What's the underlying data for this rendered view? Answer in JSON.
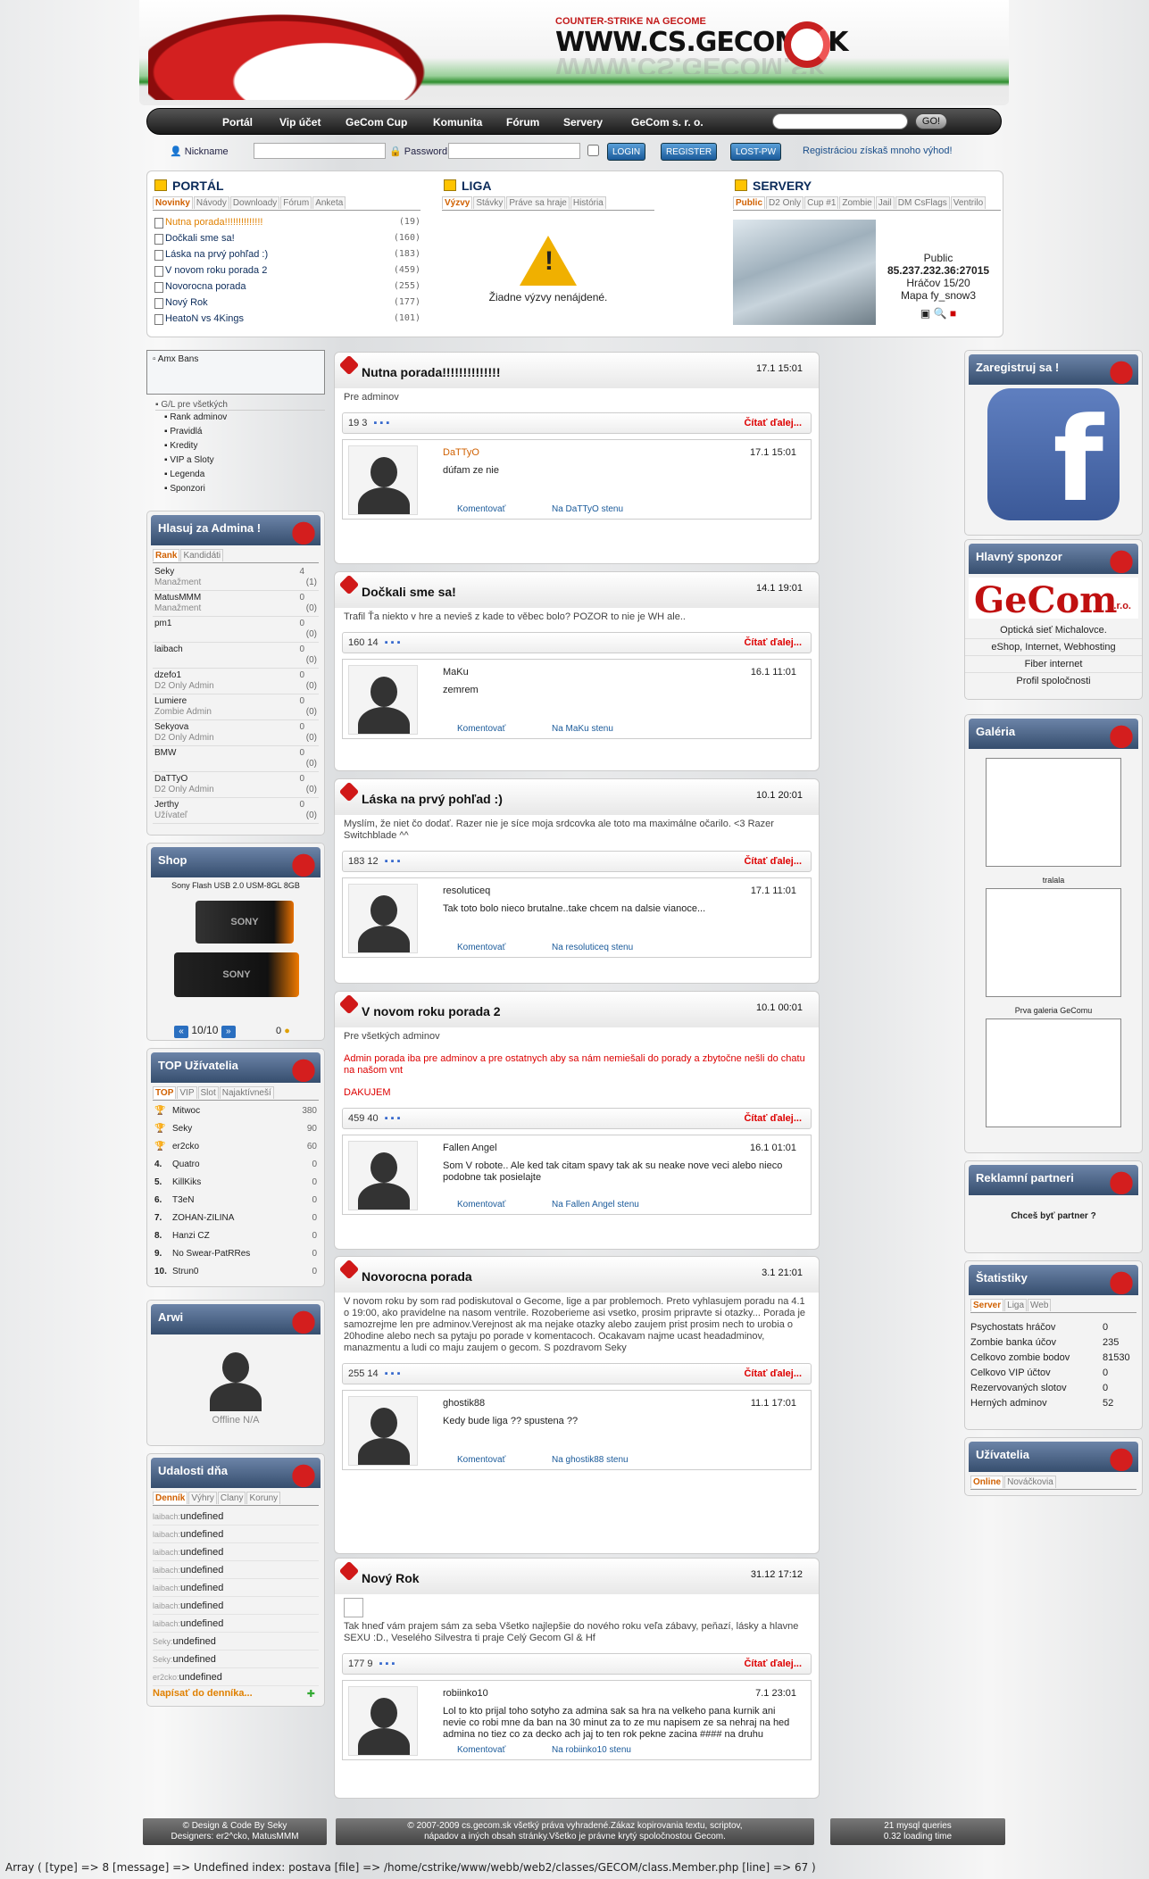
{
  "header": {
    "small": "COUNTER-STRIKE NA GECOME",
    "big": "WWW.CS.GECOM.SK"
  },
  "nav": {
    "items": [
      "Portál",
      "Vip účet",
      "GeCom Cup",
      "Komunita",
      "Fórum",
      "Servery",
      "GeCom s. r. o."
    ],
    "go": "GO!"
  },
  "login": {
    "nickname": "Nickname",
    "password": "Password",
    "login_btn": "LOGIN",
    "register_btn": "REGISTER",
    "lost_btn": "LOST-PW",
    "promo": "Registráciou získaš mnoho výhod!"
  },
  "portal": {
    "title": "PORTÁL",
    "tabs": [
      "Novinky",
      "Návody",
      "Downloady",
      "Fórum",
      "Anketa"
    ],
    "items": [
      {
        "t": "Nutna porada!!!!!!!!!!!!!!",
        "n": "(19)"
      },
      {
        "t": "Dočkali sme sa!",
        "n": "(160)"
      },
      {
        "t": "Láska na prvý pohľad :)",
        "n": "(183)"
      },
      {
        "t": "V novom roku porada 2",
        "n": "(459)"
      },
      {
        "t": "Novorocna porada",
        "n": "(255)"
      },
      {
        "t": "Nový Rok",
        "n": "(177)"
      },
      {
        "t": "HeatoN vs 4Kings",
        "n": "(101)"
      }
    ]
  },
  "liga": {
    "title": "LIGA",
    "tabs": [
      "Výzvy",
      "Stávky",
      "Práve sa hraje",
      "História"
    ],
    "empty": "Žiadne výzvy nenájdené."
  },
  "servery": {
    "title": "SERVERY",
    "tabs": [
      "Public",
      "D2 Only",
      "Cup #1",
      "Zombie",
      "Jail",
      "DM CsFlags",
      "Ventrilo"
    ],
    "name": "Public",
    "ip": "85.237.232.36:27015",
    "players": "Hráčov 15/20",
    "map": "Mapa fy_snow3"
  },
  "left": {
    "amx": "Amx Bans",
    "gl": "G/L pre všetkých",
    "gl_items": [
      "Rank adminov",
      "Pravidlá",
      "Kredity",
      "VIP a Sloty",
      "Legenda",
      "Sponzori"
    ],
    "vote_title": "Hlasuj za Admina !",
    "vote_tabs": [
      "Rank",
      "Kandidáti"
    ],
    "votes": [
      {
        "n": "Seky",
        "r": "Manažment",
        "a": "4",
        "b": "(1)"
      },
      {
        "n": "MatusMMM",
        "r": "Manažment",
        "a": "0",
        "b": "(0)"
      },
      {
        "n": "pm1",
        "r": "",
        "a": "0",
        "b": "(0)"
      },
      {
        "n": "laibach",
        "r": "",
        "a": "0",
        "b": "(0)"
      },
      {
        "n": "dzefo1",
        "r": "D2 Only Admin",
        "a": "0",
        "b": "(0)"
      },
      {
        "n": "Lumiere",
        "r": "Zombie Admin",
        "a": "0",
        "b": "(0)"
      },
      {
        "n": "Sekyova",
        "r": "D2 Only Admin",
        "a": "0",
        "b": "(0)"
      },
      {
        "n": "BMW",
        "r": "",
        "a": "0",
        "b": "(0)"
      },
      {
        "n": "DaTTyO",
        "r": "D2 Only Admin",
        "a": "0",
        "b": "(0)"
      },
      {
        "n": "Jerthy",
        "r": "Užívateľ",
        "a": "0",
        "b": "(0)"
      }
    ],
    "shop_title": "Shop",
    "shop_item": "Sony Flash USB 2.0 USM-8GL 8GB",
    "shop_pages": "10/10",
    "shop_count": "0",
    "top_title": "TOP Užívatelia",
    "top_tabs": [
      "TOP",
      "VIP",
      "Slot",
      "Najaktívneší"
    ],
    "top": [
      {
        "r": "",
        "n": "Mitwoc",
        "v": "380"
      },
      {
        "r": "",
        "n": "Seky",
        "v": "90"
      },
      {
        "r": "",
        "n": "er2cko",
        "v": "60"
      },
      {
        "r": "4.",
        "n": "Quatro",
        "v": "0"
      },
      {
        "r": "5.",
        "n": "KillKiks",
        "v": "0"
      },
      {
        "r": "6.",
        "n": "T3eN",
        "v": "0"
      },
      {
        "r": "7.",
        "n": "ZOHAN-ZILINA",
        "v": "0"
      },
      {
        "r": "8.",
        "n": "Hanzi CZ",
        "v": "0"
      },
      {
        "r": "9.",
        "n": "No Swear-PatRRes",
        "v": "0"
      },
      {
        "r": "10.",
        "n": "Strun0",
        "v": "0"
      }
    ],
    "arwi_title": "Arwi",
    "arwi_status": "Offline N/A",
    "events_title": "Udalosti dňa",
    "events_tabs": [
      "Denník",
      "Výhry",
      "Clany",
      "Koruny"
    ],
    "events": [
      {
        "u": "laibach:",
        "t": "undefined"
      },
      {
        "u": "laibach:",
        "t": "undefined"
      },
      {
        "u": "laibach:",
        "t": "undefined"
      },
      {
        "u": "laibach:",
        "t": "undefined"
      },
      {
        "u": "laibach:",
        "t": "undefined"
      },
      {
        "u": "laibach:",
        "t": "undefined"
      },
      {
        "u": "laibach:",
        "t": "undefined"
      },
      {
        "u": "Seky:",
        "t": "undefined"
      },
      {
        "u": "Seky:",
        "t": "undefined"
      },
      {
        "u": "er2cko:",
        "t": "undefined"
      }
    ],
    "write": "Napísať do denníka..."
  },
  "posts": [
    {
      "title": "Nutna porada!!!!!!!!!!!!!!",
      "date": "17.1 15:01",
      "body": "Pre adminov",
      "red": "",
      "red2": "",
      "counts": "19  3",
      "more": "Čítať ďalej...",
      "who": "DaTTyO",
      "cdate": "17.1 15:01",
      "ctext": "dúfam ze nie",
      "link1": "Komentovať",
      "link2": "Na DaTTyO stenu"
    },
    {
      "title": "Dočkali sme sa!",
      "date": "14.1 19:01",
      "body": "Trafil Ťa niekto v hre a nevieš z kade to věbec bolo? POZOR to nie je WH ale..",
      "red": "",
      "red2": "",
      "counts": "160  14",
      "more": "Čítať ďalej...",
      "who": "MaKu",
      "cdate": "16.1 11:01",
      "ctext": "zemrem",
      "link1": "Komentovať",
      "link2": "Na MaKu stenu"
    },
    {
      "title": "Láska na prvý pohľad :)",
      "date": "10.1 20:01",
      "body": "Myslím, že niet čo dodať. Razer nie je síce moja srdcovka ale toto ma maximálne očarilo. <3 Razer Switchblade ^^",
      "red": "",
      "red2": "",
      "counts": "183  12",
      "more": "Čítať ďalej...",
      "who": "resoluticeq",
      "cdate": "17.1 11:01",
      "ctext": "Tak toto bolo nieco brutalne..take chcem na dalsie vianoce...",
      "link1": "Komentovať",
      "link2": "Na resoluticeq stenu"
    },
    {
      "title": "V novom roku porada 2",
      "date": "10.1 00:01",
      "body": "Pre všetkých adminov",
      "red": "Admin porada iba pre adminov a pre ostatnych aby sa nám nemiešali do porady a zbytočne nešli do chatu na našom vnt",
      "red2": "DAKUJEM",
      "counts": "459  40",
      "more": "Čítať ďalej...",
      "who": "Fallen Angel",
      "cdate": "16.1 01:01",
      "ctext": "Som V robote.. Ale ked tak citam spavy tak ak su neake nove veci alebo nieco podobne tak posielajte",
      "link1": "Komentovať",
      "link2": "Na Fallen Angel stenu"
    },
    {
      "title": "Novorocna porada",
      "date": "3.1 21:01",
      "body": "V novom roku by som rad podiskutoval o Gecome, lige a par problemoch. Preto vyhlasujem poradu na 4.1 o 19:00, ako pravidelne na nasom ventrile. Rozoberieme asi vsetko, prosim pripravte si otazky... Porada je samozrejme len pre adminov.Verejnost ak ma nejake otazky alebo zaujem prist prosim nech to urobia o 20hodine alebo nech sa pytaju po porade v komentacoch. Ocakavam najme ucast headadminov, manazmentu a ludi co maju zaujem o gecom. S pozdravom Seky",
      "red": "",
      "red2": "",
      "counts": "255  14",
      "more": "Čítať ďalej...",
      "who": "ghostik88",
      "cdate": "11.1 17:01",
      "ctext": "Kedy bude liga ?? spustena ??",
      "link1": "Komentovať",
      "link2": "Na ghostik88 stenu"
    },
    {
      "title": "Nový Rok",
      "date": "31.12 17:12",
      "body": "Tak hneď vám prajem sám za seba Všetko najlepšie do nového roku veľa zábavy, peňazí, lásky a hlavne SEXU :D., Veselého Silvestra ti praje Celý Gecom Gl & Hf",
      "red": "",
      "red2": "",
      "counts": "177  9",
      "more": "Čítať ďalej...",
      "who": "robiinko10",
      "cdate": "7.1 23:01",
      "ctext": "Lol to kto prijal toho sotyho za admina sak sa hra na velkeho pana kurnik ani nevie co robi mne da ban na 30 minut za to ze mu napisem ze sa nehraj na hed admina no tiez co za decko ach jaj to ten rok pekne zacina #### na druhu",
      "link1": "Komentovať",
      "link2": "Na robiinko10 stenu"
    }
  ],
  "right": {
    "reg_title": "Zaregistruj sa !",
    "sponsor_title": "Hlavný sponzor",
    "sponsor_logo": "GeCom",
    "sponsor_sub": "s.r.o.",
    "sponsor_items": [
      "Optická sieť Michalovce.",
      "eShop, Internet, Webhosting",
      "Fiber internet",
      "Profil spoločnosti"
    ],
    "gallery_title": "Galéria",
    "gallery": [
      "",
      "tralala",
      "Prva galeria GeComu"
    ],
    "partners_title": "Reklamní partneri",
    "partners_text": "Chceš byť partner ?",
    "stats_title": "Štatistiky",
    "stats_tabs": [
      "Server",
      "Liga",
      "Web"
    ],
    "stats": [
      {
        "k": "Psychostats hráčov",
        "v": "0"
      },
      {
        "k": "Zombie banka účov",
        "v": "235"
      },
      {
        "k": "Celkovo zombie bodov",
        "v": "81530"
      },
      {
        "k": "Celkovo VIP účtov",
        "v": "0"
      },
      {
        "k": "Rezervovaných slotov",
        "v": "0"
      },
      {
        "k": "Herných adminov",
        "v": "52"
      }
    ],
    "users_title": "Užívatelia",
    "users_tabs": [
      "Online",
      "Nováčkovia"
    ]
  },
  "footer": {
    "left1": "© Design & Code By Seky",
    "left2": "Designers: er2^cko, MatusMMM",
    "mid1": "© 2007-2009 cs.gecom.sk všetký práva vyhradené.Zákaz kopirovania textu, scriptov,",
    "mid2": "nápadov a iných obsah stránky.Všetko je právne krytý spoločnostou Gecom.",
    "right1": "21 mysql queries",
    "right2": "0.32 loading time"
  },
  "error": "Array ( [type] => 8 [message] => Undefined index: postava [file] => /home/cstrike/www/webb/web2/classes/GECOM/class.Member.php [line] => 67 )"
}
